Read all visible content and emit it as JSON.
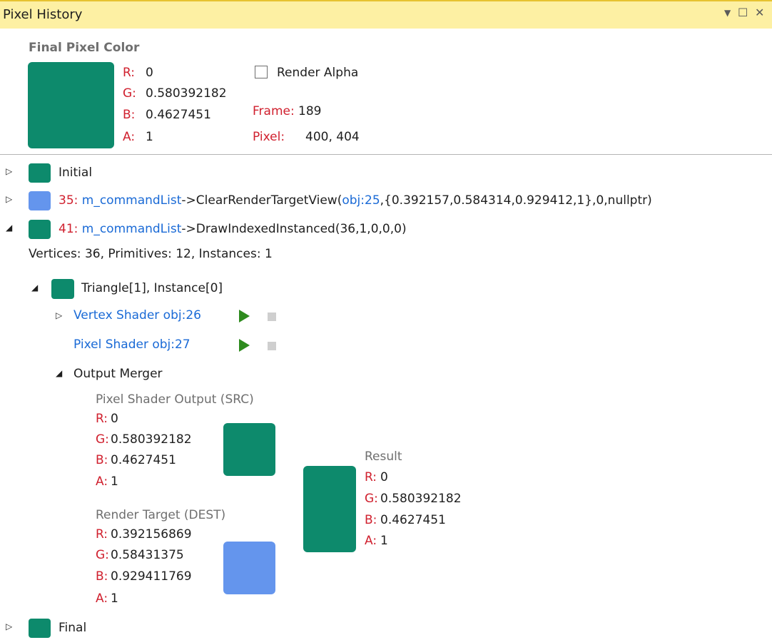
{
  "window": {
    "title": "Pixel History",
    "dropdown_glyph": "▼",
    "maximize_glyph": "☐",
    "close_glyph": "✕"
  },
  "final_pixel": {
    "heading": "Final Pixel Color",
    "color": "#0d8a6c",
    "r_label": "R:",
    "r_value": "0",
    "g_label": "G:",
    "g_value": "0.580392182",
    "b_label": "B:",
    "b_value": "0.4627451",
    "a_label": "A:",
    "a_value": "1",
    "render_alpha_label": "Render Alpha",
    "render_alpha_checked": false,
    "frame_label": "Frame:",
    "frame_value": "189",
    "pixel_label": "Pixel:",
    "pixel_value": "400, 404"
  },
  "history": {
    "initial": {
      "label": "Initial",
      "color": "#0d8a6c"
    },
    "clear": {
      "color": "#6495ed",
      "event_id": "35:",
      "object": "m_commandList",
      "arrow": "->",
      "call_start": "ClearRenderTargetView(",
      "obj_ref": "obj:25",
      "call_end": ",{0.392157,0.584314,0.929412,1},0,nullptr)"
    },
    "draw": {
      "color": "#0d8a6c",
      "event_id": "41:",
      "object": "m_commandList",
      "arrow": "->",
      "call": "DrawIndexedInstanced(36,1,0,0,0)",
      "stats": "Vertices: 36, Primitives: 12, Instances: 1",
      "triangle": {
        "label": "Triangle[1], Instance[0]",
        "color": "#0d8a6c",
        "vertex_shader": "Vertex Shader obj:26",
        "pixel_shader": "Pixel Shader obj:27",
        "output_merger": {
          "label": "Output Merger",
          "src": {
            "heading": "Pixel Shader Output (SRC)",
            "color": "#0d8a6c",
            "r_label": "R:",
            "r_value": "0",
            "g_label": "G:",
            "g_value": "0.580392182",
            "b_label": "B:",
            "b_value": "0.4627451",
            "a_label": "A:",
            "a_value": "1"
          },
          "dest": {
            "heading": "Render Target (DEST)",
            "color": "#6495ed",
            "r_label": "R:",
            "r_value": "0.392156869",
            "g_label": "G:",
            "g_value": "0.58431375",
            "b_label": "B:",
            "b_value": "0.929411769",
            "a_label": "A:",
            "a_value": "1"
          },
          "result": {
            "heading": "Result",
            "color": "#0d8a6c",
            "r_label": "R:",
            "r_value": "0",
            "g_label": "G:",
            "g_value": "0.580392182",
            "b_label": "B:",
            "b_value": "0.4627451",
            "a_label": "A:",
            "a_value": "1"
          }
        }
      }
    },
    "final": {
      "label": "Final",
      "color": "#0d8a6c"
    }
  }
}
